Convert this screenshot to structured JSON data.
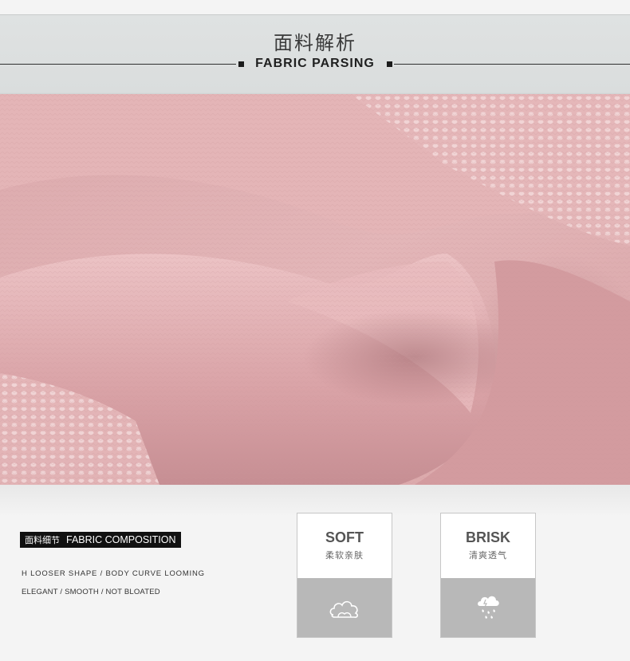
{
  "header": {
    "title_cn": "面料解析",
    "title_en": "FABRIC PARSING"
  },
  "photo": {
    "subject": "fabric-closeup",
    "fabric_color": "#dba7aa"
  },
  "composition": {
    "label_cn": "面料细节",
    "label_en": "FABRIC COMPOSITION",
    "line1": "H LOOSER SHAPE / BODY CURVE LOOMING",
    "line2": "ELEGANT / SMOOTH / NOT BLOATED"
  },
  "features": [
    {
      "title": "SOFT",
      "subtitle": "柔软亲肤",
      "icon": "cloud-icon"
    },
    {
      "title": "BRISK",
      "subtitle": "清爽透气",
      "icon": "rain-cloud-icon"
    }
  ]
}
